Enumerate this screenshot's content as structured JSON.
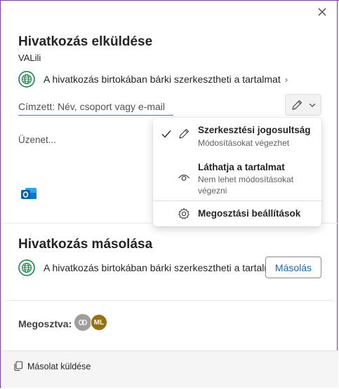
{
  "dialog": {
    "title": "Hivatkozás elküldése",
    "item_name": "VALili",
    "permission_text": "A hivatkozás birtokában bárki szerkesztheti a tartalmat",
    "recipient_placeholder": "Címzett: Név, csoport vagy e-mail",
    "message_placeholder": "Üzenet...",
    "icons": {
      "close": "close-icon",
      "globe": "globe-icon",
      "edit": "pencil-icon",
      "outlook": "outlook-icon"
    }
  },
  "permission_menu": {
    "items": [
      {
        "title": "Szerkesztési jogosultság",
        "description": "Módosításokat végezhet",
        "selected": true,
        "icon": "pencil-icon"
      },
      {
        "title": "Láthatja a tartalmat",
        "description": "Nem lehet módosításokat végezni",
        "selected": false,
        "icon": "eye-icon"
      },
      {
        "title": "Megosztási beállítások",
        "icon": "gear-icon"
      }
    ]
  },
  "copy_link": {
    "title": "Hivatkozás másolása",
    "permission_text": "A hivatkozás birtokában bárki szerkesztheti a tartalmat",
    "button_label": "Másolás"
  },
  "shared": {
    "label": "Megosztva:",
    "avatars": [
      {
        "type": "link",
        "icon": "link-icon",
        "color": "#a19f9d"
      },
      {
        "initials": "ML",
        "color": "#986f0b"
      }
    ]
  },
  "footer": {
    "send_copy_label": "Másolat küldése",
    "icon": "copy-icon"
  },
  "colors": {
    "accent": "#0f6cbd",
    "frame": "#7a3fa6",
    "globe": "#107c41"
  }
}
